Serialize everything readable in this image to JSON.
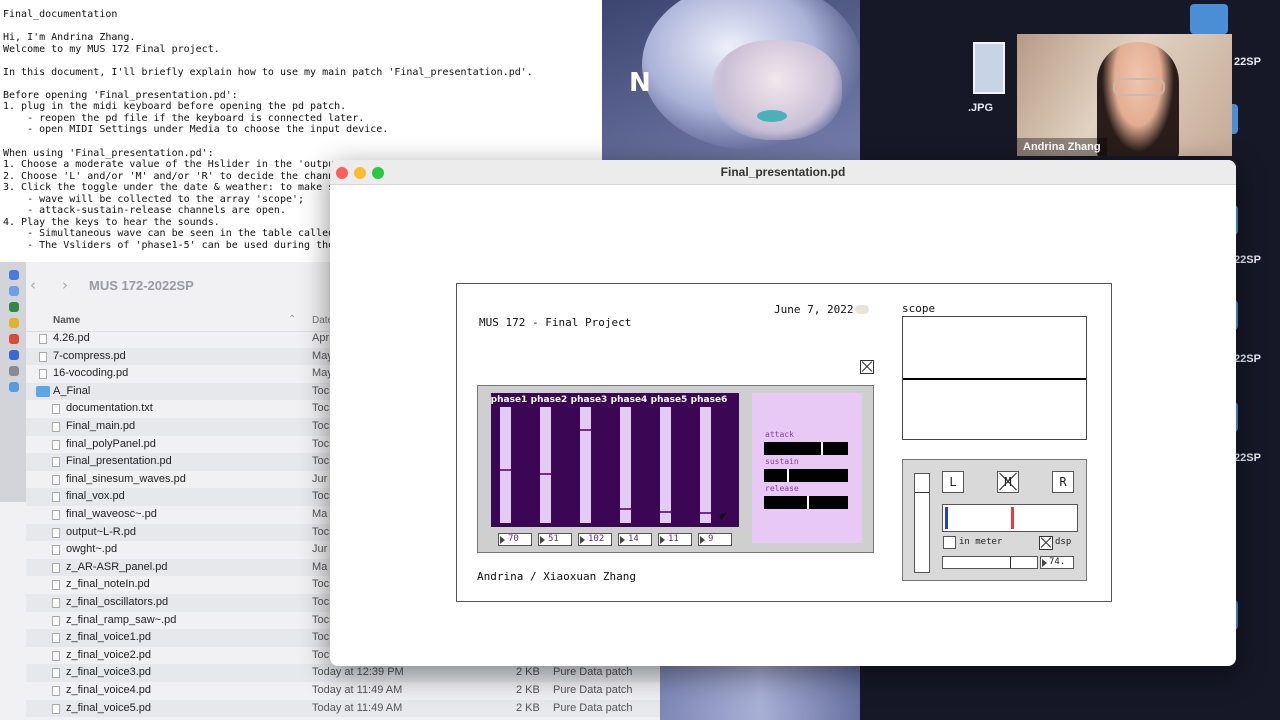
{
  "doc": {
    "lines": [
      "Final_documentation",
      "",
      "Hi, I'm Andrina Zhang.",
      "Welcome to my MUS 172 Final project.",
      "",
      "In this document, I'll briefly explain how to use my main patch 'Final_presentation.pd'.",
      "",
      "Before opening 'Final_presentation.pd':",
      "1. plug in the midi keyboard before opening the pd patch.",
      "    - reopen the pd file if the keyboard is connected later.",
      "    - open MIDI Settings under Media to choose the input device.",
      "",
      "When using 'Final_presentation.pd':",
      "1. Choose a moderate value of the Hslider in the 'output",
      "2. Choose 'L' and/or 'M' and/or 'R' to decide the channe",
      "3. Click the toggle under the date & weather: to make su",
      "    - wave will be collected to the array 'scope';",
      "    - attack-sustain-release channels are open.",
      "4. Play the keys to hear the sounds.",
      "    - Simultaneous wave can be seen in the table called",
      "    - The Vsliders of 'phase1-5' can be used during the"
    ]
  },
  "finder": {
    "title": "MUS 172-2022SP",
    "col_name": "Name",
    "col_date": "Date",
    "rows": [
      {
        "name": "4.26.pd",
        "date": "Apr",
        "size": "",
        "kind": ""
      },
      {
        "name": "7-compress.pd",
        "date": "May",
        "size": "",
        "kind": ""
      },
      {
        "name": "16-vocoding.pd",
        "date": "May",
        "size": "",
        "kind": ""
      },
      {
        "name": "A_Final",
        "date": "Toc",
        "size": "",
        "kind": ""
      },
      {
        "name": "documentation.txt",
        "date": "Toc",
        "size": "",
        "kind": ""
      },
      {
        "name": "Final_main.pd",
        "date": "Toc",
        "size": "",
        "kind": ""
      },
      {
        "name": "final_polyPanel.pd",
        "date": "Toc",
        "size": "",
        "kind": ""
      },
      {
        "name": "Final_presentation.pd",
        "date": "Toc",
        "size": "",
        "kind": ""
      },
      {
        "name": "final_sinesum_waves.pd",
        "date": "Jur",
        "size": "",
        "kind": ""
      },
      {
        "name": "final_vox.pd",
        "date": "Toc",
        "size": "",
        "kind": ""
      },
      {
        "name": "final_waveosc~.pd",
        "date": "Ma",
        "size": "",
        "kind": ""
      },
      {
        "name": "output~L-R.pd",
        "date": "Toc",
        "size": "",
        "kind": ""
      },
      {
        "name": "owght~.pd",
        "date": "Jur",
        "size": "",
        "kind": ""
      },
      {
        "name": "z_AR-ASR_panel.pd",
        "date": "Ma",
        "size": "",
        "kind": ""
      },
      {
        "name": "z_final_noteIn.pd",
        "date": "Toc",
        "size": "",
        "kind": ""
      },
      {
        "name": "z_final_oscillators.pd",
        "date": "Toc",
        "size": "",
        "kind": ""
      },
      {
        "name": "z_final_ramp_saw~.pd",
        "date": "Toc",
        "size": "",
        "kind": ""
      },
      {
        "name": "z_final_voice1.pd",
        "date": "Toc",
        "size": "",
        "kind": ""
      },
      {
        "name": "z_final_voice2.pd",
        "date": "Toc",
        "size": "",
        "kind": ""
      },
      {
        "name": "z_final_voice3.pd",
        "date": "Today at 12:39 PM",
        "size": "2 KB",
        "kind": "Pure Data patch"
      },
      {
        "name": "z_final_voice4.pd",
        "date": "Today at 11:49 AM",
        "size": "2 KB",
        "kind": "Pure Data patch"
      },
      {
        "name": "z_final_voice5.pd",
        "date": "Today at 11:49 AM",
        "size": "2 KB",
        "kind": "Pure Data patch"
      }
    ]
  },
  "desktop": {
    "jpg_label": ".JPG",
    "labels": [
      "22SP",
      "22SP",
      "22SP",
      "22SP",
      "22SP"
    ],
    "webcam_name": "Andrina Zhang"
  },
  "pd": {
    "window_title": "Final_presentation.pd",
    "project_title": "MUS 172 - Final Project",
    "date": "June 7, 2022",
    "author": "Andrina / Xiaoxuan Zhang",
    "scope_label": "scope",
    "phases": [
      {
        "label": "phase1",
        "value": "70",
        "level": 0.46
      },
      {
        "label": "phase2",
        "value": "51",
        "level": 0.42
      },
      {
        "label": "phase3",
        "value": "102",
        "level": 0.81
      },
      {
        "label": "phase4",
        "value": "14",
        "level": 0.11
      },
      {
        "label": "phase5",
        "value": "11",
        "level": 0.09
      },
      {
        "label": "phase6",
        "value": "9",
        "level": 0.08
      }
    ],
    "envelope": [
      {
        "label": "attack",
        "level": 0.69
      },
      {
        "label": "sustain",
        "level": 0.28
      },
      {
        "label": "release",
        "level": 0.53
      }
    ],
    "channels": [
      "L",
      "M",
      "R"
    ],
    "in_meter_label": "in meter",
    "dsp_label": "dsp",
    "output_value": "74.",
    "output_level": 0.71
  }
}
